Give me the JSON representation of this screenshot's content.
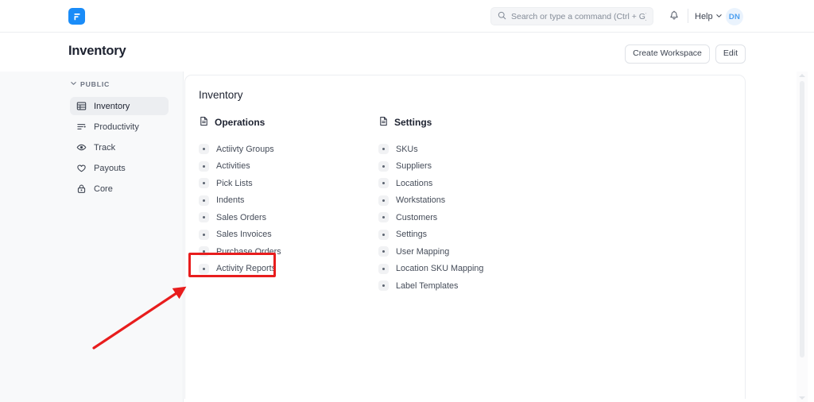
{
  "topbar": {
    "logo_icon": "flowstate-f-logo",
    "search": {
      "icon": "search-icon",
      "placeholder": "Search or type a command (Ctrl + G)",
      "value": ""
    },
    "bell_icon": "notification-bell-icon",
    "help_label": "Help",
    "help_chevron_icon": "chevron-down-icon",
    "avatar_initials": "DN"
  },
  "page_header": {
    "title": "Inventory",
    "create_workspace_label": "Create Workspace",
    "edit_label": "Edit"
  },
  "sidebar": {
    "section_label": "PUBLIC",
    "section_chevron_icon": "chevron-down-icon",
    "items": [
      {
        "label": "Inventory",
        "icon": "table-grid-icon",
        "active": true
      },
      {
        "label": "Productivity",
        "icon": "filter-lines-icon",
        "active": false
      },
      {
        "label": "Track",
        "icon": "eye-icon",
        "active": false
      },
      {
        "label": "Payouts",
        "icon": "heart-icon",
        "active": false
      },
      {
        "label": "Core",
        "icon": "lock-icon",
        "active": false
      }
    ]
  },
  "card": {
    "title": "Inventory",
    "columns": [
      {
        "heading": "Operations",
        "heading_icon": "document-icon",
        "items": [
          {
            "label": "Actiivty Groups"
          },
          {
            "label": "Activities"
          },
          {
            "label": "Pick Lists"
          },
          {
            "label": "Indents"
          },
          {
            "label": "Sales Orders"
          },
          {
            "label": "Sales Invoices"
          },
          {
            "label": "Purchase Orders"
          },
          {
            "label": "Activity Reports",
            "highlighted": true
          }
        ]
      },
      {
        "heading": "Settings",
        "heading_icon": "document-icon",
        "items": [
          {
            "label": "SKUs"
          },
          {
            "label": "Suppliers"
          },
          {
            "label": "Locations"
          },
          {
            "label": "Workstations"
          },
          {
            "label": "Customers"
          },
          {
            "label": "Settings"
          },
          {
            "label": "User Mapping"
          },
          {
            "label": "Location SKU Mapping"
          },
          {
            "label": "Label Templates"
          }
        ]
      }
    ]
  },
  "annotation": {
    "highlight_color": "#e81d1d",
    "target_label": "Activity Reports",
    "arrow_icon": "red-pointer-arrow"
  },
  "scrollbar": {
    "up_arrow_icon": "scroll-up-arrow-icon",
    "down_arrow_icon": "scroll-down-arrow-icon"
  }
}
